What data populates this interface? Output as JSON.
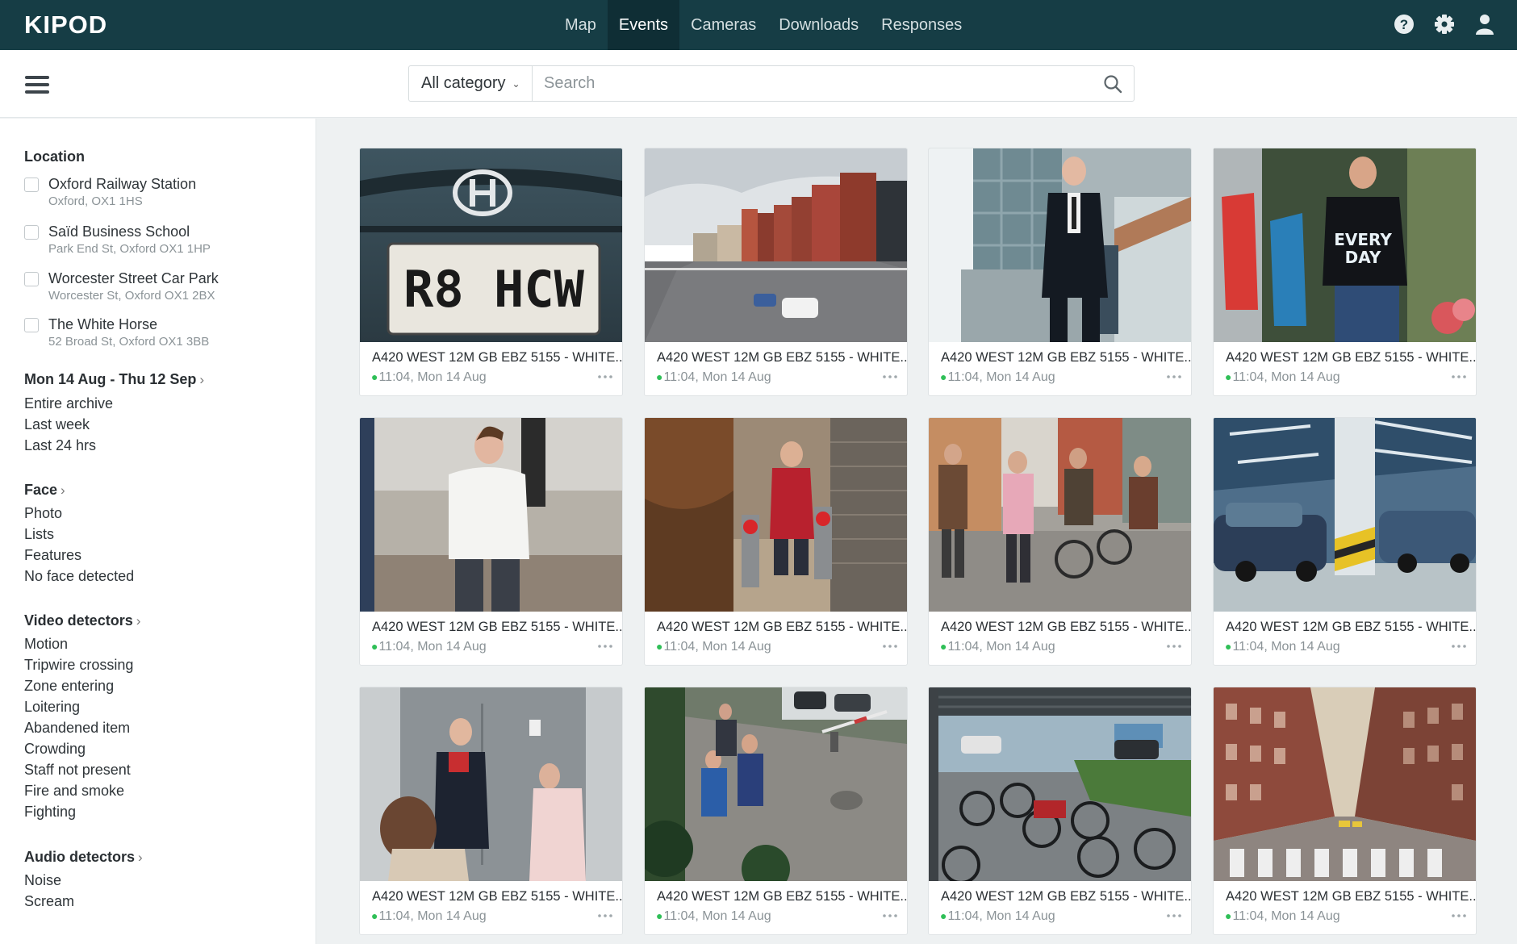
{
  "app": {
    "logo": "KIPOD"
  },
  "nav": {
    "items": [
      {
        "label": "Map"
      },
      {
        "label": "Events"
      },
      {
        "label": "Cameras"
      },
      {
        "label": "Downloads"
      },
      {
        "label": "Responses"
      }
    ],
    "active": "Events"
  },
  "icons": {
    "help": "help-icon",
    "settings": "gear-icon",
    "user": "user-icon",
    "menu": "hamburger-icon",
    "search": "search-icon"
  },
  "search": {
    "category": "All category",
    "placeholder": "Search",
    "value": ""
  },
  "sidebar": {
    "location": {
      "title": "Location",
      "items": [
        {
          "name": "Oxford Railway Station",
          "address": "Oxford, OX1 1HS",
          "checked": false
        },
        {
          "name": "Saïd Business School",
          "address": "Park End St, Oxford OX1 1HP",
          "checked": false
        },
        {
          "name": "Worcester Street Car Park",
          "address": "Worcester St, Oxford OX1 2BX",
          "checked": false
        },
        {
          "name": "The White Horse",
          "address": "52 Broad St, Oxford OX1 3BB",
          "checked": false
        }
      ]
    },
    "date": {
      "title": "Mon 14 Aug - Thu 12 Sep",
      "options": [
        "Entire archive",
        "Last week",
        "Last 24 hrs"
      ]
    },
    "face": {
      "title": "Face",
      "options": [
        "Photo",
        "Lists",
        "Features",
        "No face detected"
      ]
    },
    "video": {
      "title": "Video detectors",
      "options": [
        "Motion",
        "Tripwire crossing",
        "Zone entering",
        "Loitering",
        "Abandened item",
        "Crowding",
        "Staff not present",
        "Fire and smoke",
        "Fighting"
      ]
    },
    "audio": {
      "title": "Audio detectors",
      "options": [
        "Noise",
        "Scream"
      ]
    }
  },
  "events": [
    {
      "title": "A420 WEST 12M GB EBZ 5155 - WHITE...",
      "time": "11:04, Mon 14 Aug",
      "scene": "license-plate"
    },
    {
      "title": "A420 WEST 12M GB EBZ 5155 - WHITE...",
      "time": "11:04, Mon 14 Aug",
      "scene": "street"
    },
    {
      "title": "A420 WEST 12M GB EBZ 5155 - WHITE...",
      "time": "11:04, Mon 14 Aug",
      "scene": "man-in-suit"
    },
    {
      "title": "A420 WEST 12M GB EBZ 5155 - WHITE...",
      "time": "11:04, Mon 14 Aug",
      "scene": "man-tshirt"
    },
    {
      "title": "A420 WEST 12M GB EBZ 5155 - WHITE...",
      "time": "11:04, Mon 14 Aug",
      "scene": "man-white-shirt"
    },
    {
      "title": "A420 WEST 12M GB EBZ 5155 - WHITE...",
      "time": "11:04, Mon 14 Aug",
      "scene": "turnstile"
    },
    {
      "title": "A420 WEST 12M GB EBZ 5155 - WHITE...",
      "time": "11:04, Mon 14 Aug",
      "scene": "crowd-street"
    },
    {
      "title": "A420 WEST 12M GB EBZ 5155 - WHITE...",
      "time": "11:04, Mon 14 Aug",
      "scene": "parking-garage"
    },
    {
      "title": "A420 WEST 12M GB EBZ 5155 - WHITE...",
      "time": "11:04, Mon 14 Aug",
      "scene": "elevator"
    },
    {
      "title": "A420 WEST 12M GB EBZ 5155 - WHITE...",
      "time": "11:04, Mon 14 Aug",
      "scene": "sidewalk-cctv"
    },
    {
      "title": "A420 WEST 12M GB EBZ 5155 - WHITE...",
      "time": "11:04, Mon 14 Aug",
      "scene": "bike-shelter"
    },
    {
      "title": "A420 WEST 12M GB EBZ 5155 - WHITE...",
      "time": "11:04, Mon 14 Aug",
      "scene": "city-avenue"
    }
  ],
  "plate_text": "R8 HCW",
  "colors": {
    "topbar": "#163d45",
    "active_tab": "#0f2e35",
    "status_dot": "#2fbf57"
  }
}
